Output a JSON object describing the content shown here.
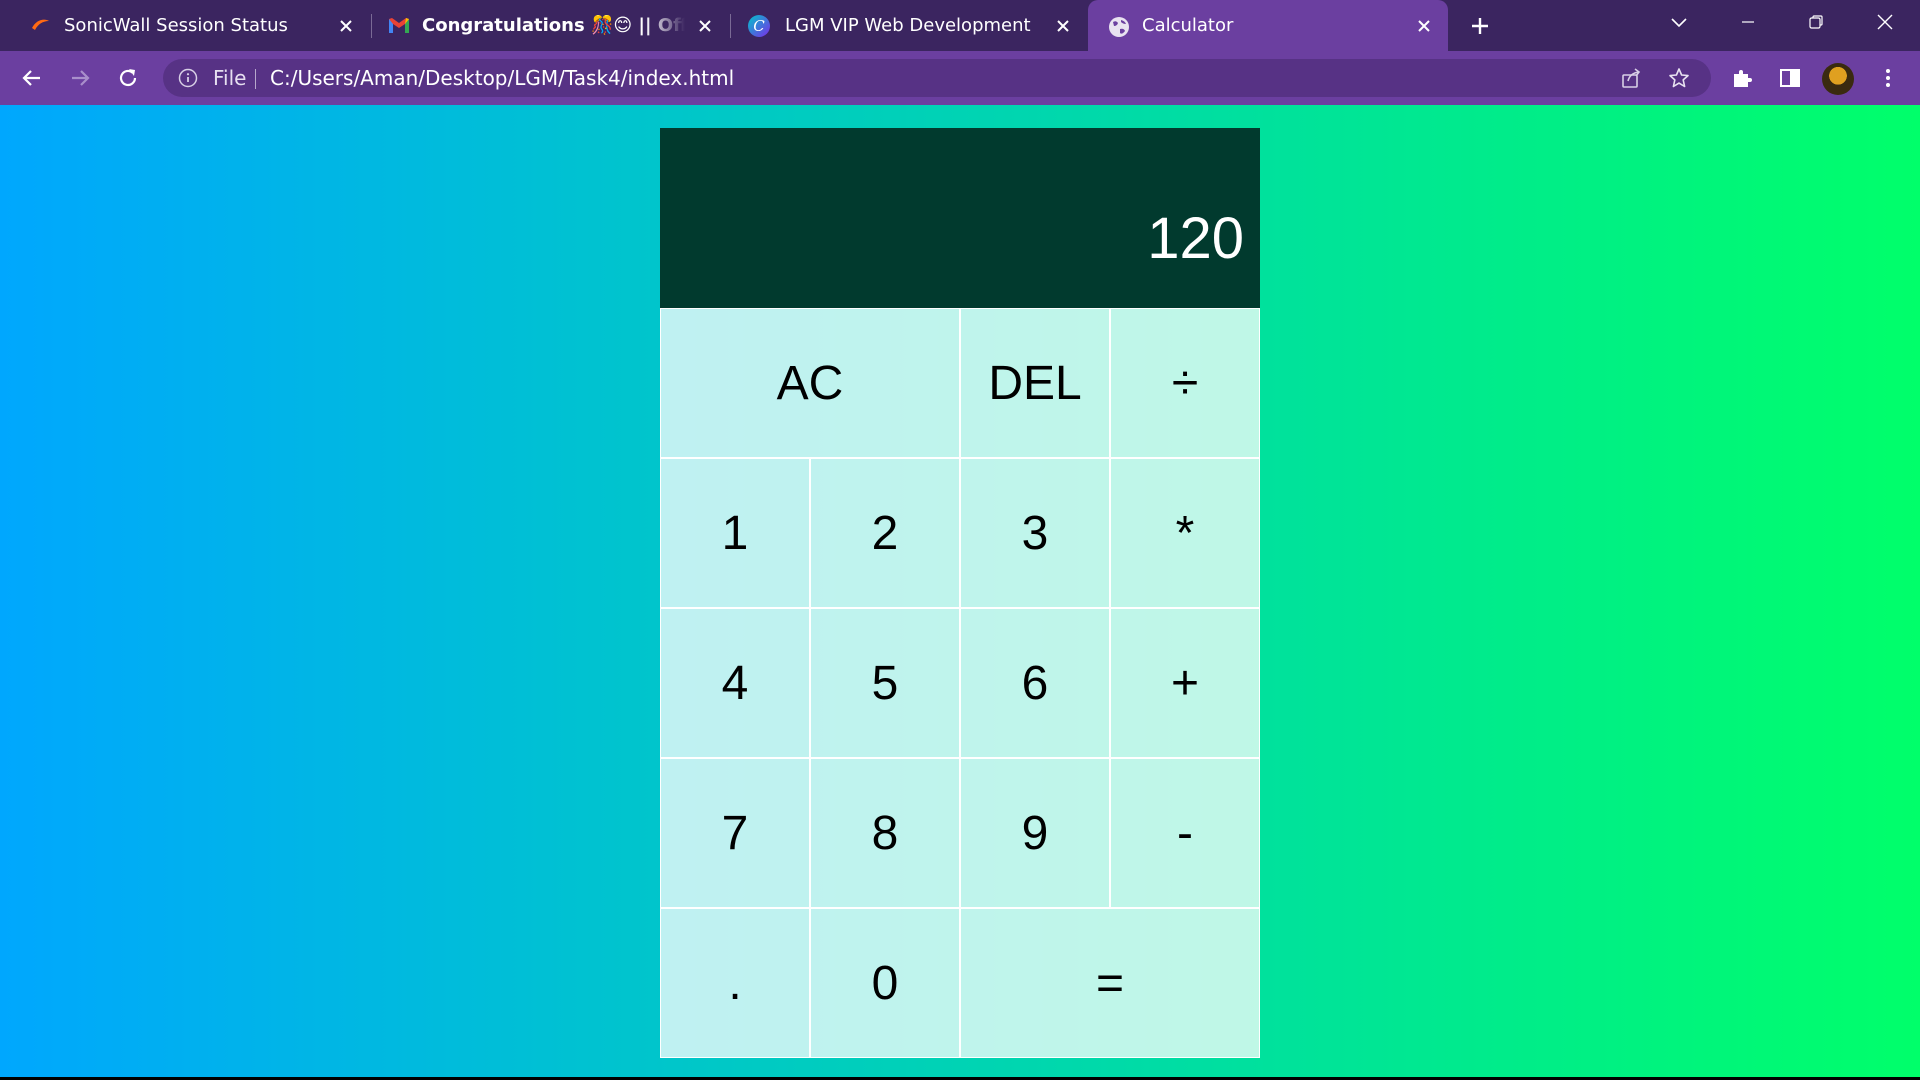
{
  "browser": {
    "tabs": [
      {
        "title": "SonicWall Session Status",
        "icon": "sonicwall-icon"
      },
      {
        "title": "Congratulations 🎊😊 || Offer Le",
        "icon": "gmail-icon"
      },
      {
        "title": "LGM VIP Web Development",
        "icon": "canva-icon"
      },
      {
        "title": "Calculator",
        "icon": "globe-icon",
        "active": true
      }
    ],
    "address": {
      "scheme_label": "File",
      "url": "C:/Users/Aman/Desktop/LGM/Task4/index.html"
    },
    "colors": {
      "tabstrip": "#3b2560",
      "toolbar": "#6b3fa0",
      "omnibox": "#573285"
    }
  },
  "calculator": {
    "display_value": "120",
    "keys": {
      "ac": "AC",
      "del": "DEL",
      "divide": "÷",
      "one": "1",
      "two": "2",
      "three": "3",
      "multiply": "*",
      "four": "4",
      "five": "5",
      "six": "6",
      "add": "+",
      "seven": "7",
      "eight": "8",
      "nine": "9",
      "subtract": "-",
      "decimal": ".",
      "zero": "0",
      "equals": "="
    },
    "colors": {
      "display_bg": "#013a2e",
      "gradient_start": "#00a7fe",
      "gradient_end": "#00ff6a"
    }
  }
}
